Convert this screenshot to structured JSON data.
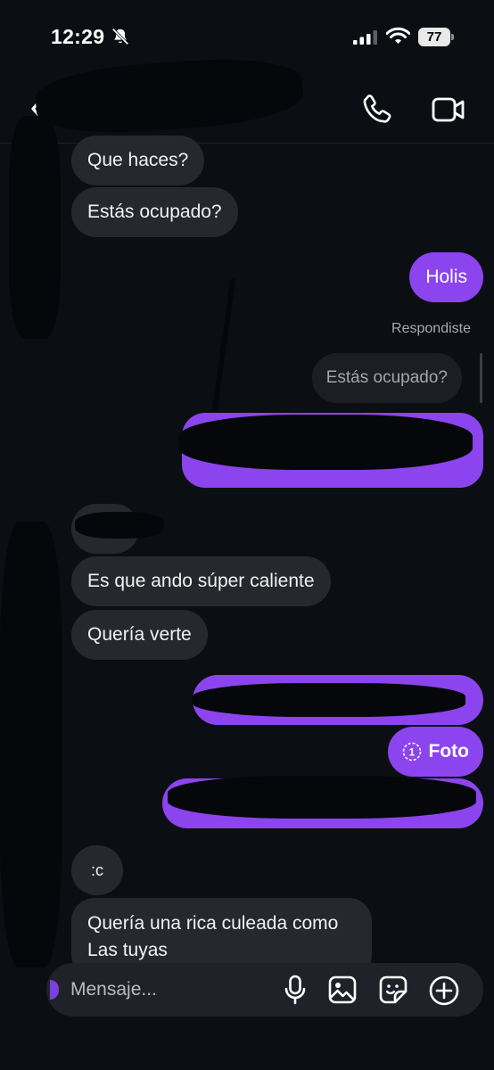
{
  "status_bar": {
    "time": "12:29",
    "battery": "77"
  },
  "header": {
    "back_icon": "chevron-left-icon",
    "call_icon": "phone-icon",
    "video_icon": "video-camera-icon"
  },
  "messages": {
    "in_1": "Que haces?",
    "in_2": "Estás ocupado?",
    "out_1": "Holis",
    "reply_label": "Respondiste",
    "reply_quote": "Estás ocupado?",
    "in_3": "Es que ando súper caliente",
    "in_4": "Quería verte",
    "foto_label": "Foto",
    "foto_count": "1",
    "in_5": ":c",
    "in_6_line1": "Quería una rica culeada como",
    "in_6_line2": "Las tuyas"
  },
  "composer": {
    "placeholder": "Mensaje..."
  },
  "colors": {
    "outgoing": "#8c44ee",
    "incoming": "#25292e",
    "background": "#0b0f13"
  }
}
